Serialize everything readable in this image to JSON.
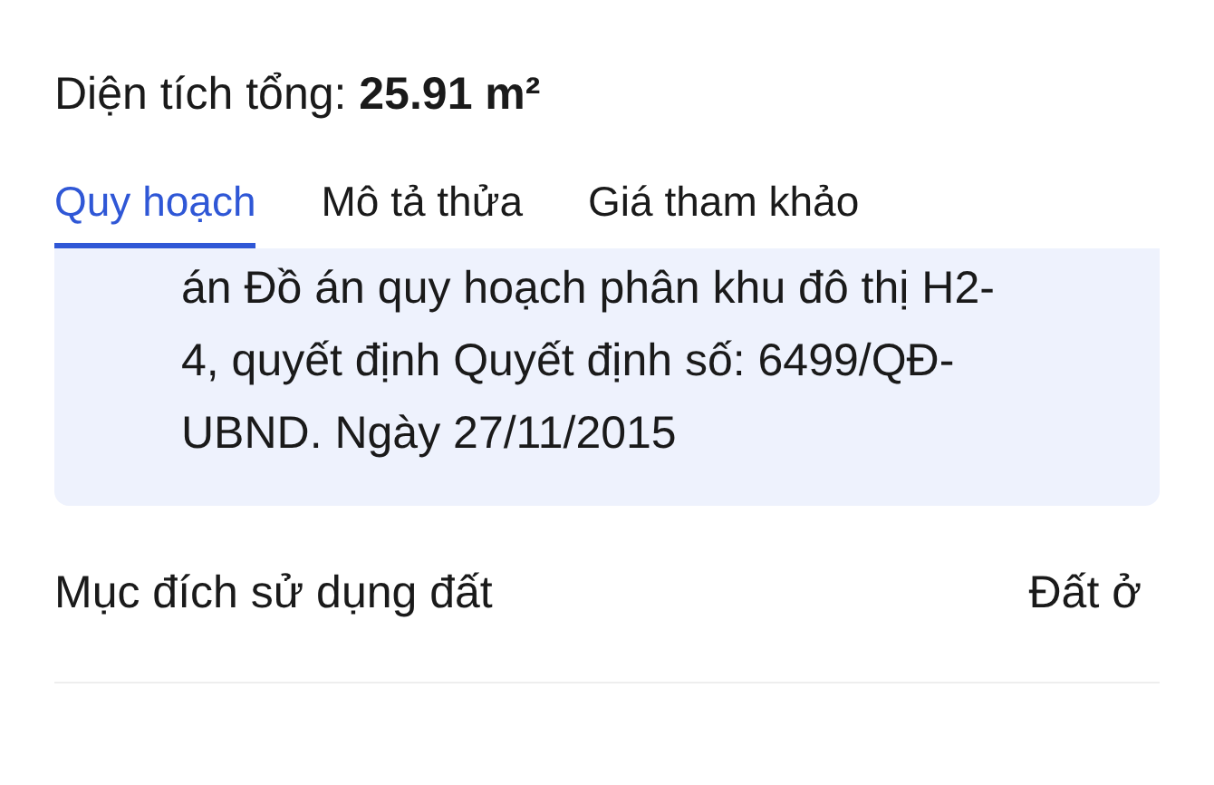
{
  "summary": {
    "text": "Diện tích tổng: **25.91 m²**"
  },
  "tabs": [
    {
      "label": "Quy hoạch",
      "selected": true
    },
    {
      "label": "Mô tả thửa",
      "selected": false
    },
    {
      "label": "Giá tham khảo",
      "selected": false
    }
  ],
  "planning_note": {
    "lines": [
      "án Đồ án quy hoạch phân khu đô thị H2-",
      "4, quyết định Quyết định số: 6499/QĐ-",
      "UBND. Ngày 27/11/2015"
    ]
  },
  "details": [
    {
      "label": "Mục đích sử dụng đất",
      "value": "Đất ở"
    }
  ]
}
